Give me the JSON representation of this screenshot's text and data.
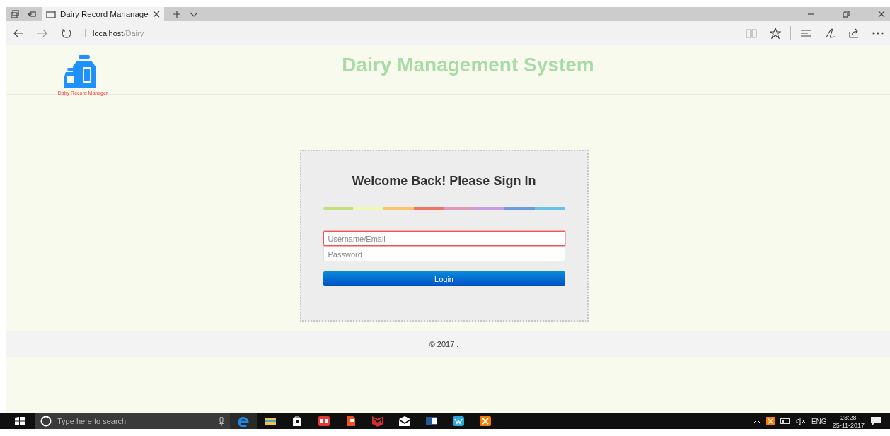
{
  "browser": {
    "tab_title": "Dairy Record Mananage",
    "url_host": "localhost",
    "url_path": "/Dairy"
  },
  "header": {
    "logo_caption": "Dairy Record Manager",
    "title": "Dairy Management System"
  },
  "login": {
    "heading": "Welcome Back! Please Sign In",
    "fields": [
      {
        "placeholder": "Username/Email",
        "focused": true
      },
      {
        "placeholder": "Password",
        "focused": false
      }
    ],
    "button": "Login"
  },
  "footer": {
    "text": "© 2017 ."
  },
  "taskbar": {
    "search_placeholder": "Type here to search",
    "language": "ENG",
    "time": "23:28",
    "date": "25-11-2017"
  }
}
